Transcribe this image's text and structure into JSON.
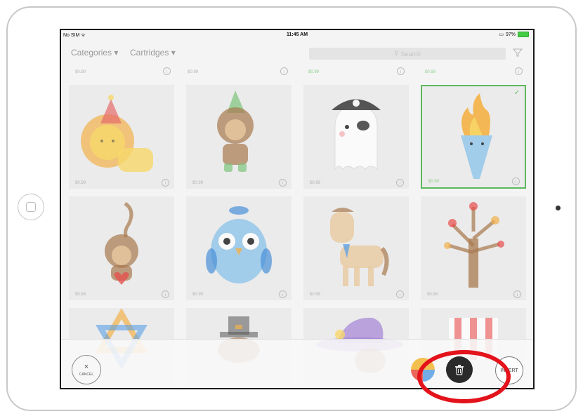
{
  "statusbar": {
    "carrier": "No SIM",
    "time": "11:45 AM",
    "battery": "97%"
  },
  "navbar": {
    "categories_label": "Categories ▾",
    "cartridges_label": "Cartridges ▾",
    "search_placeholder": "Search"
  },
  "top_prices": [
    "$0.99",
    "$0.99",
    "$0.99",
    "$0.99"
  ],
  "tiles": [
    {
      "name": "Party Lion",
      "price": "$0.99",
      "selected": false
    },
    {
      "name": "Elf Monkey",
      "price": "$0.99",
      "selected": false
    },
    {
      "name": "Pirate Ghost",
      "price": "$0.99",
      "selected": false
    },
    {
      "name": "Torch",
      "price": "$0.99",
      "selected": true
    },
    {
      "name": "Hanging Monkey",
      "price": "$0.99",
      "selected": false
    },
    {
      "name": "Owl",
      "price": "$0.99",
      "selected": false
    },
    {
      "name": "Horse",
      "price": "$0.99",
      "selected": false
    },
    {
      "name": "Autumn Tree",
      "price": "$0.99",
      "selected": false
    }
  ],
  "info_glyph": "i",
  "check_glyph": "✓",
  "toolbar": {
    "cancel_icon": "×",
    "cancel_label": "CANCEL",
    "insert_label": "INSERT"
  },
  "colors": {
    "accent_green": "#5cb85c",
    "highlight_red": "#e3121b",
    "trash_bg": "#2a2a2a"
  }
}
